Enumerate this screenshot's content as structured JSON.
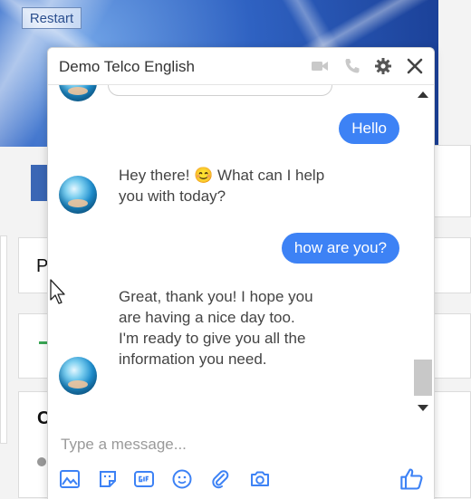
{
  "background": {
    "restart_label": "Restart",
    "card_text_p": "P",
    "card_text_c": "C"
  },
  "chat": {
    "title": "Demo Telco English",
    "header_icons": [
      "video-icon",
      "phone-icon",
      "gear-icon",
      "close-icon"
    ],
    "messages": [
      {
        "from": "user",
        "text": "Hello"
      },
      {
        "from": "bot",
        "text": "Hey there! 😊 What can I help you with today?"
      },
      {
        "from": "user",
        "text": "how are you?"
      },
      {
        "from": "bot",
        "text": "Great, thank you! I hope you are having a nice day too. I'm ready to give you all the information you need."
      }
    ],
    "input_placeholder": "Type a message...",
    "toolbar_icons": [
      "image-icon",
      "sticker-icon",
      "gif-icon",
      "emoji-icon",
      "attachment-icon",
      "camera-icon",
      "like-icon"
    ],
    "colors": {
      "accent": "#3d82f5",
      "bot_text": "#444444"
    }
  }
}
